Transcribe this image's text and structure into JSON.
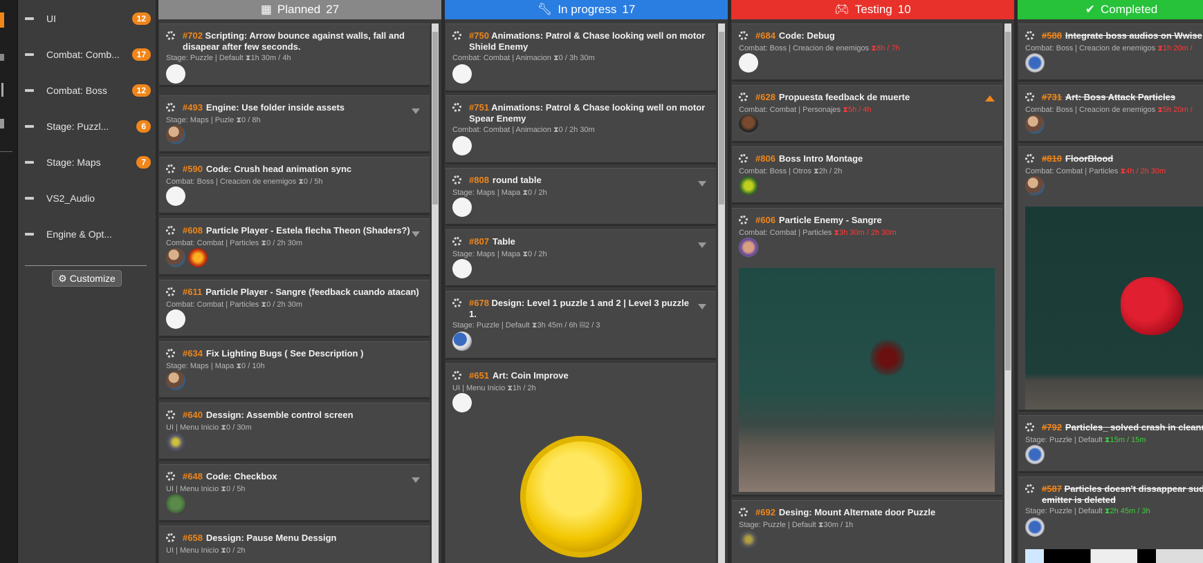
{
  "sidebar": {
    "items": [
      {
        "label": "UI",
        "badge": "12"
      },
      {
        "label": "Combat: Comb...",
        "badge": "17"
      },
      {
        "label": "Combat: Boss",
        "badge": "12"
      },
      {
        "label": "Stage: Puzzl...",
        "badge": "6"
      },
      {
        "label": "Stage: Maps",
        "badge": "7"
      },
      {
        "label": "VS2_Audio",
        "badge": ""
      },
      {
        "label": "Engine & Opt...",
        "badge": ""
      }
    ],
    "customize_label": "Customize"
  },
  "colors": {
    "planned": "#888888",
    "inprogress": "#2a7de1",
    "testing": "#e8312a",
    "completed": "#27c23a",
    "accent": "#f0861a"
  },
  "columns": [
    {
      "title": "Planned",
      "count": "27",
      "icon": "calendar-icon"
    },
    {
      "title": "In progress",
      "count": "17",
      "icon": "wrench-icon"
    },
    {
      "title": "Testing",
      "count": "10",
      "icon": "gamepad-icon"
    },
    {
      "title": "Completed",
      "count": "",
      "icon": "check-icon"
    }
  ],
  "planned": [
    {
      "num": "#702",
      "title": "Scripting: Arrow bounce against walls, fall and",
      "title2": "disapear after few seconds.",
      "meta": "Stage: Puzzle | Default",
      "time": "1h 30m / 4h"
    },
    {
      "num": "#493",
      "title": "Engine: Use folder inside assets",
      "meta": "Stage: Maps | Puzle",
      "time": "0 / 8h"
    },
    {
      "num": "#590",
      "title": "Code: Crush head animation sync",
      "meta": "Combat: Boss | Creacion de enemigos",
      "time": "0 / 5h"
    },
    {
      "num": "#608",
      "title": "Particle Player - Estela flecha Theon (Shaders?)",
      "meta": "Combat: Combat | Particles",
      "time": "0 / 2h 30m"
    },
    {
      "num": "#611",
      "title": "Particle Player - Sangre (feedback cuando atacan)",
      "meta": "Combat: Combat | Particles",
      "time": "0 / 2h 30m"
    },
    {
      "num": "#634",
      "title": "Fix Lighting Bugs ( See Description )",
      "meta": "Stage: Maps | Mapa",
      "time": "0 / 10h"
    },
    {
      "num": "#640",
      "title": "Dessign: Assemble control screen",
      "meta": "UI | Menu Inicio",
      "time": "0 / 30m"
    },
    {
      "num": "#648",
      "title": "Code: Checkbox",
      "meta": "UI | Menu Inicio",
      "time": "0 / 5h"
    },
    {
      "num": "#658",
      "title": "Dessign: Pause Menu Dessign",
      "meta": "UI | Menu Inicio",
      "time": "0 / 2h"
    }
  ],
  "inprogress": [
    {
      "num": "#750",
      "title": "Animations: Patrol & Chase looking well on motor",
      "title2": "Shield Enemy",
      "meta": "Combat: Combat | Animacion",
      "time": "0 / 3h 30m"
    },
    {
      "num": "#751",
      "title": "Animations: Patrol & Chase looking well on motor",
      "title2": "Spear Enemy",
      "meta": "Combat: Combat | Animacion",
      "time": "0 / 2h 30m"
    },
    {
      "num": "#808",
      "title": "round table",
      "meta": "Stage: Maps | Mapa",
      "time": "0 / 2h"
    },
    {
      "num": "#807",
      "title": "Table",
      "meta": "Stage: Maps | Mapa",
      "time": "0 / 2h"
    },
    {
      "num": "#678",
      "title": "Design: Level 1 puzzle 1 and 2 | Level 3 puzzle",
      "title2": "1.",
      "meta": "Stage: Puzzle | Default",
      "time": "3h 45m / 6h",
      "extra": "2 / 3"
    },
    {
      "num": "#651",
      "title": "Art: Coin Improve",
      "meta": "UI | Menu Inicio",
      "time": "1h / 2h"
    }
  ],
  "testing": [
    {
      "num": "#684",
      "title": "Code: Debug",
      "meta": "Combat: Boss | Creacion de enemigos",
      "time": "8h / 7h"
    },
    {
      "num": "#628",
      "title": "Propuesta feedback de muerte",
      "meta": "Combat: Combat | Personajes",
      "time": "5h / 4h"
    },
    {
      "num": "#806",
      "title": "Boss Intro Montage",
      "meta": "Combat: Boss | Otros",
      "time": "2h / 2h"
    },
    {
      "num": "#606",
      "title": "Particle Enemy - Sangre",
      "meta": "Combat: Combat | Particles",
      "time": "3h 30m / 2h 30m"
    },
    {
      "num": "#692",
      "title": "Desing: Mount Alternate door Puzzle",
      "meta": "Stage: Puzzle | Default",
      "time": "30m / 1h"
    }
  ],
  "completed": [
    {
      "num": "#588",
      "title": "Integrate boss audios on Wwise",
      "meta": "Combat: Boss | Creacion de enemigos",
      "time": "1h 20m /"
    },
    {
      "num": "#731",
      "title": "Art: Boss Attack Particles",
      "meta": "Combat: Boss | Creacion de enemigos",
      "time": "5h 20m /"
    },
    {
      "num": "#810",
      "title": "FloorBlood",
      "meta": "Combat: Combat | Particles",
      "time": "4h / 2h 30m"
    },
    {
      "num": "#792",
      "title": "Particles_ solved crash in cleanup",
      "meta": "Stage: Puzzle | Default",
      "time": "15m / 15m"
    },
    {
      "num": "#587",
      "title": "Particles doesn't dissappear sude",
      "title2": "emitter is deleted",
      "meta": "Stage: Puzzle | Default",
      "time": "2h 45m / 3h"
    }
  ]
}
